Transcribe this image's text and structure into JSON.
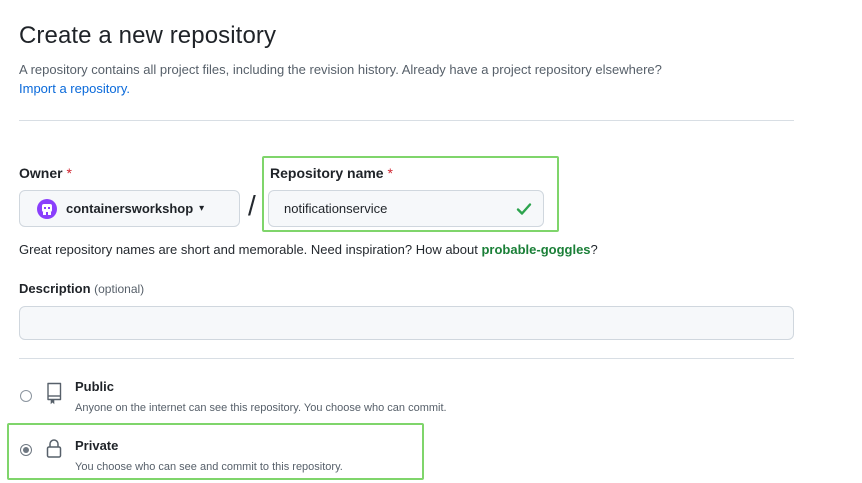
{
  "header": {
    "title": "Create a new repository",
    "subtitle": "A repository contains all project files, including the revision history. Already have a project repository elsewhere?",
    "import_link": "Import a repository."
  },
  "owner": {
    "label": "Owner",
    "required_mark": "*",
    "value": "containersworkshop",
    "caret": "▾",
    "avatar_icon": "org-avatar-icon"
  },
  "separator": "/",
  "repo_name": {
    "label": "Repository name",
    "required_mark": "*",
    "value": "notificationservice",
    "status_icon": "check-icon",
    "status_color": "#2da44e"
  },
  "hint": {
    "prefix": "Great repository names are short and memorable. Need inspiration? How about ",
    "suggestion": "probable-goggles",
    "suffix": "?"
  },
  "description": {
    "label": "Description",
    "optional": "(optional)",
    "value": ""
  },
  "visibility": {
    "selected": "private",
    "options": [
      {
        "id": "public",
        "title": "Public",
        "description": "Anyone on the internet can see this repository. You choose who can commit.",
        "icon": "repo-icon"
      },
      {
        "id": "private",
        "title": "Private",
        "description": "You choose who can see and commit to this repository.",
        "icon": "lock-icon"
      }
    ]
  },
  "colors": {
    "highlight": "#7fd56b",
    "link": "#0969da",
    "suggestion": "#1a7f37",
    "required": "#cf222e"
  }
}
